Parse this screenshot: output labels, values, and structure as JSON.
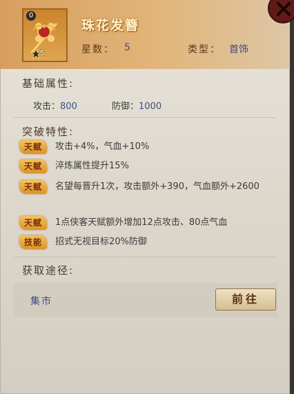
{
  "item": {
    "name": "珠花发簪",
    "count": "0",
    "star_level": "5",
    "stars_label": "星数：",
    "stars_value": "5",
    "type_label": "类型：",
    "type_value": "首饰"
  },
  "base_attributes": {
    "title": "基础属性:",
    "attack_label": "攻击：",
    "attack_value": "800",
    "defense_label": "防御：",
    "defense_value": "1000"
  },
  "breakthrough": {
    "title": "突破特性:",
    "traits": [
      {
        "tag": "天赋",
        "text": "攻击+4%，气血+10%"
      },
      {
        "tag": "天赋",
        "text": "淬炼属性提升15%"
      },
      {
        "tag": "天赋",
        "text": "名望每晋升1次，攻击额外+390，气血额外+2600"
      },
      {
        "tag": "天赋",
        "text": "1点侠客天赋额外增加12点攻击、80点气血"
      },
      {
        "tag": "技能",
        "text": "招式无视目标20%防御"
      }
    ]
  },
  "acquisition": {
    "title": "获取途径:",
    "source": "集市",
    "goto_label": "前往"
  },
  "colors": {
    "header": "#e2b57a",
    "tag": "#e0a040",
    "value_blue": "#3f4f82",
    "close_button": "#5e1b17"
  }
}
